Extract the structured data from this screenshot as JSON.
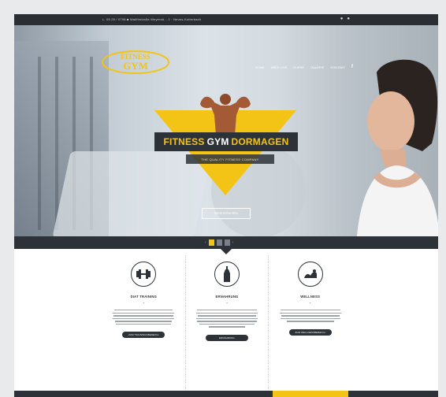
{
  "topbar": {
    "info": "L. 05 25 / 0798 ■ Wallfirstraße Weyersb... 1 · Neuss-Kutterbach"
  },
  "brand": {
    "logo_line1": "FITNESS",
    "logo_line2": "GYM"
  },
  "nav": {
    "items": [
      "HOME",
      "ÜBER UNS",
      "KURSE",
      "GALERIE",
      "KONTAKT"
    ]
  },
  "hero": {
    "title_word1": "FITNESS",
    "title_word2": "GYM",
    "title_word3": "DORMAGEN",
    "subtitle": "THE QUALITY FITNESS COMPANY",
    "button": "MEHR ERFAHREN"
  },
  "features": [
    {
      "title": "DIAT TRAINING",
      "button": "ZUM TRAININGSBEREICH",
      "icon": "dumbbell-icon"
    },
    {
      "title": "ERNAHRUNG",
      "button": "ERNÄHRUNG",
      "icon": "bottle-icon"
    },
    {
      "title": "WELLNESS",
      "button": "ZUM WELLNESSBEREICH",
      "icon": "wellness-icon"
    }
  ],
  "colors": {
    "accent": "#f3c316",
    "dark": "#2d3238"
  }
}
